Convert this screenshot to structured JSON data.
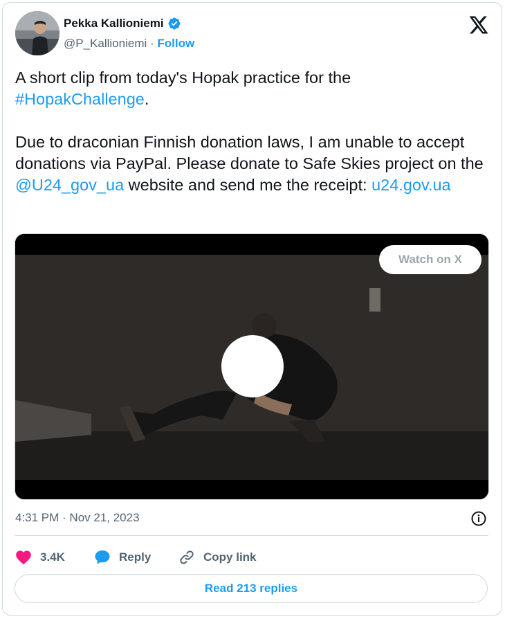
{
  "author": {
    "name": "Pekka Kallioniemi",
    "handle": "@P_Kallioniemi",
    "separator": "·",
    "follow_label": "Follow",
    "verified_icon": "verified-badge-icon",
    "avatar_icon": "avatar-photo"
  },
  "brand_icon": "x-logo-icon",
  "tweet": {
    "line1": "A short clip from today's Hopak practice for the ",
    "hashtag": "#HopakChallenge",
    "line1_end": ".",
    "para2_a": "Due to draconian Finnish donation laws, I am unable to accept donations via PayPal. Please donate to Safe Skies project on the ",
    "mention": "@U24_gov_ua",
    "para2_b": " website and send me the receipt: ",
    "url": "u24.gov.ua"
  },
  "media": {
    "watch_label": "Watch on X",
    "play_icon": "play-circle",
    "description": "video frame"
  },
  "meta": {
    "timestamp": "4:31 PM · Nov 21, 2023",
    "info_icon": "info-icon"
  },
  "actions": {
    "like_count": "3.4K",
    "like_icon": "heart-icon",
    "reply_label": "Reply",
    "reply_icon": "speech-bubble-icon",
    "copy_label": "Copy link",
    "copy_icon": "link-icon"
  },
  "read_replies_label": "Read 213 replies",
  "colors": {
    "accent": "#1d9bf0",
    "text": "#0f1419",
    "muted": "#536471",
    "border": "#cfd9de",
    "like": "#f91880"
  }
}
